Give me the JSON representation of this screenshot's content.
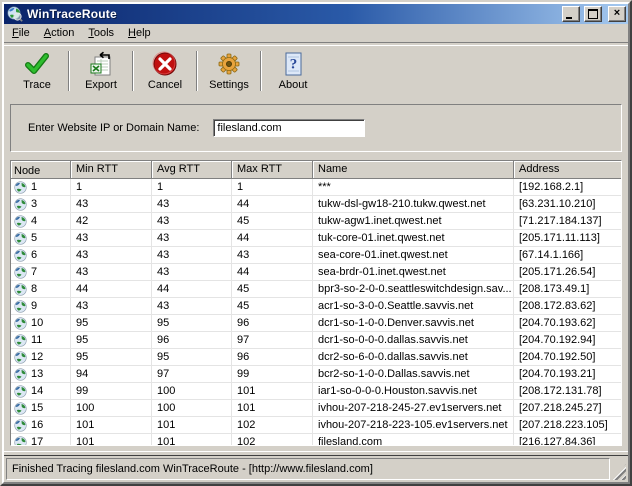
{
  "window": {
    "title": "WinTraceRoute"
  },
  "menu": {
    "items": [
      {
        "label": "File"
      },
      {
        "label": "Action"
      },
      {
        "label": "Tools"
      },
      {
        "label": "Help"
      }
    ]
  },
  "toolbar": {
    "buttons": [
      {
        "label": "Trace",
        "icon": "trace-check-icon"
      },
      {
        "label": "Export",
        "icon": "export-spreadsheet-icon"
      },
      {
        "label": "Cancel",
        "icon": "cancel-icon"
      },
      {
        "label": "Settings",
        "icon": "settings-gear-icon"
      },
      {
        "label": "About",
        "icon": "about-help-icon"
      }
    ]
  },
  "form": {
    "label": "Enter Website IP or Domain Name:",
    "value": "filesland.com"
  },
  "table": {
    "columns": [
      "Node",
      "Min RTT",
      "Avg RTT",
      "Max RTT",
      "Name",
      "Address"
    ],
    "rows": [
      {
        "node": "1",
        "min": "1",
        "avg": "1",
        "max": "1",
        "name": "***",
        "address": "[192.168.2.1]"
      },
      {
        "node": "3",
        "min": "43",
        "avg": "43",
        "max": "44",
        "name": "tukw-dsl-gw18-210.tukw.qwest.net",
        "address": "[63.231.10.210]"
      },
      {
        "node": "4",
        "min": "42",
        "avg": "43",
        "max": "45",
        "name": "tukw-agw1.inet.qwest.net",
        "address": "[71.217.184.137]"
      },
      {
        "node": "5",
        "min": "43",
        "avg": "43",
        "max": "44",
        "name": "tuk-core-01.inet.qwest.net",
        "address": "[205.171.11.113]"
      },
      {
        "node": "6",
        "min": "43",
        "avg": "43",
        "max": "43",
        "name": "sea-core-01.inet.qwest.net",
        "address": "[67.14.1.166]"
      },
      {
        "node": "7",
        "min": "43",
        "avg": "43",
        "max": "44",
        "name": "sea-brdr-01.inet.qwest.net",
        "address": "[205.171.26.54]"
      },
      {
        "node": "8",
        "min": "44",
        "avg": "44",
        "max": "45",
        "name": "bpr3-so-2-0-0.seattleswitchdesign.sav...",
        "address": "[208.173.49.1]"
      },
      {
        "node": "9",
        "min": "43",
        "avg": "43",
        "max": "45",
        "name": "acr1-so-3-0-0.Seattle.savvis.net",
        "address": "[208.172.83.62]"
      },
      {
        "node": "10",
        "min": "95",
        "avg": "95",
        "max": "96",
        "name": "dcr1-so-1-0-0.Denver.savvis.net",
        "address": "[204.70.193.62]"
      },
      {
        "node": "11",
        "min": "95",
        "avg": "96",
        "max": "97",
        "name": "dcr1-so-0-0-0.dallas.savvis.net",
        "address": "[204.70.192.94]"
      },
      {
        "node": "12",
        "min": "95",
        "avg": "95",
        "max": "96",
        "name": "dcr2-so-6-0-0.dallas.savvis.net",
        "address": "[204.70.192.50]"
      },
      {
        "node": "13",
        "min": "94",
        "avg": "97",
        "max": "99",
        "name": "bcr2-so-1-0-0.Dallas.savvis.net",
        "address": "[204.70.193.21]"
      },
      {
        "node": "14",
        "min": "99",
        "avg": "100",
        "max": "101",
        "name": "iar1-so-0-0-0.Houston.savvis.net",
        "address": "[208.172.131.78]"
      },
      {
        "node": "15",
        "min": "100",
        "avg": "100",
        "max": "101",
        "name": "ivhou-207-218-245-27.ev1servers.net",
        "address": "[207.218.245.27]"
      },
      {
        "node": "16",
        "min": "101",
        "avg": "101",
        "max": "102",
        "name": "ivhou-207-218-223-105.ev1servers.net",
        "address": "[207.218.223.105]"
      },
      {
        "node": "17",
        "min": "101",
        "avg": "101",
        "max": "102",
        "name": "filesland.com",
        "address": "[216.127.84.36]"
      }
    ]
  },
  "statusbar": {
    "text": "Finished Tracing filesland.com WinTraceRoute - [http://www.filesland.com]"
  },
  "colors": {
    "titlebar_start": "#0a246a",
    "titlebar_end": "#a6caf0",
    "window_bg": "#d4d0c8",
    "table_bg": "#ffffff",
    "grid_line": "#e4e4e4",
    "trace_green": "#22aa22",
    "cancel_red": "#cc1111",
    "gear_orange": "#e8a33d",
    "about_blue": "#2a4a9a"
  }
}
